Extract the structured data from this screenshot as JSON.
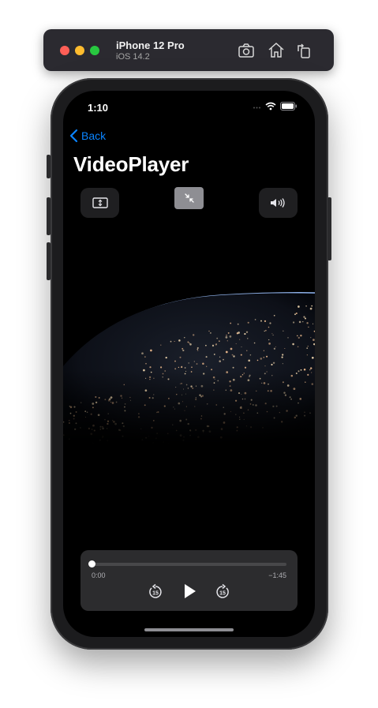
{
  "simulator": {
    "device_name": "iPhone 12 Pro",
    "os_version": "iOS 14.2",
    "icons": [
      "screenshot-icon",
      "home-icon",
      "rotate-icon"
    ]
  },
  "status_bar": {
    "time": "1:10"
  },
  "nav": {
    "back_label": "Back",
    "title": "VideoPlayer"
  },
  "controls": {
    "aspect_icon": "aspect-ratio-icon",
    "pip_icon": "pip-collapse-icon",
    "volume_icon": "speaker-volume-icon"
  },
  "player": {
    "elapsed": "0:00",
    "remaining": "−1:45",
    "progress": 0.0,
    "skip_back_seconds": "15",
    "skip_forward_seconds": "15"
  },
  "colors": {
    "accent": "#0a84ff",
    "background": "#000000",
    "panel": "#2c2c2e"
  }
}
